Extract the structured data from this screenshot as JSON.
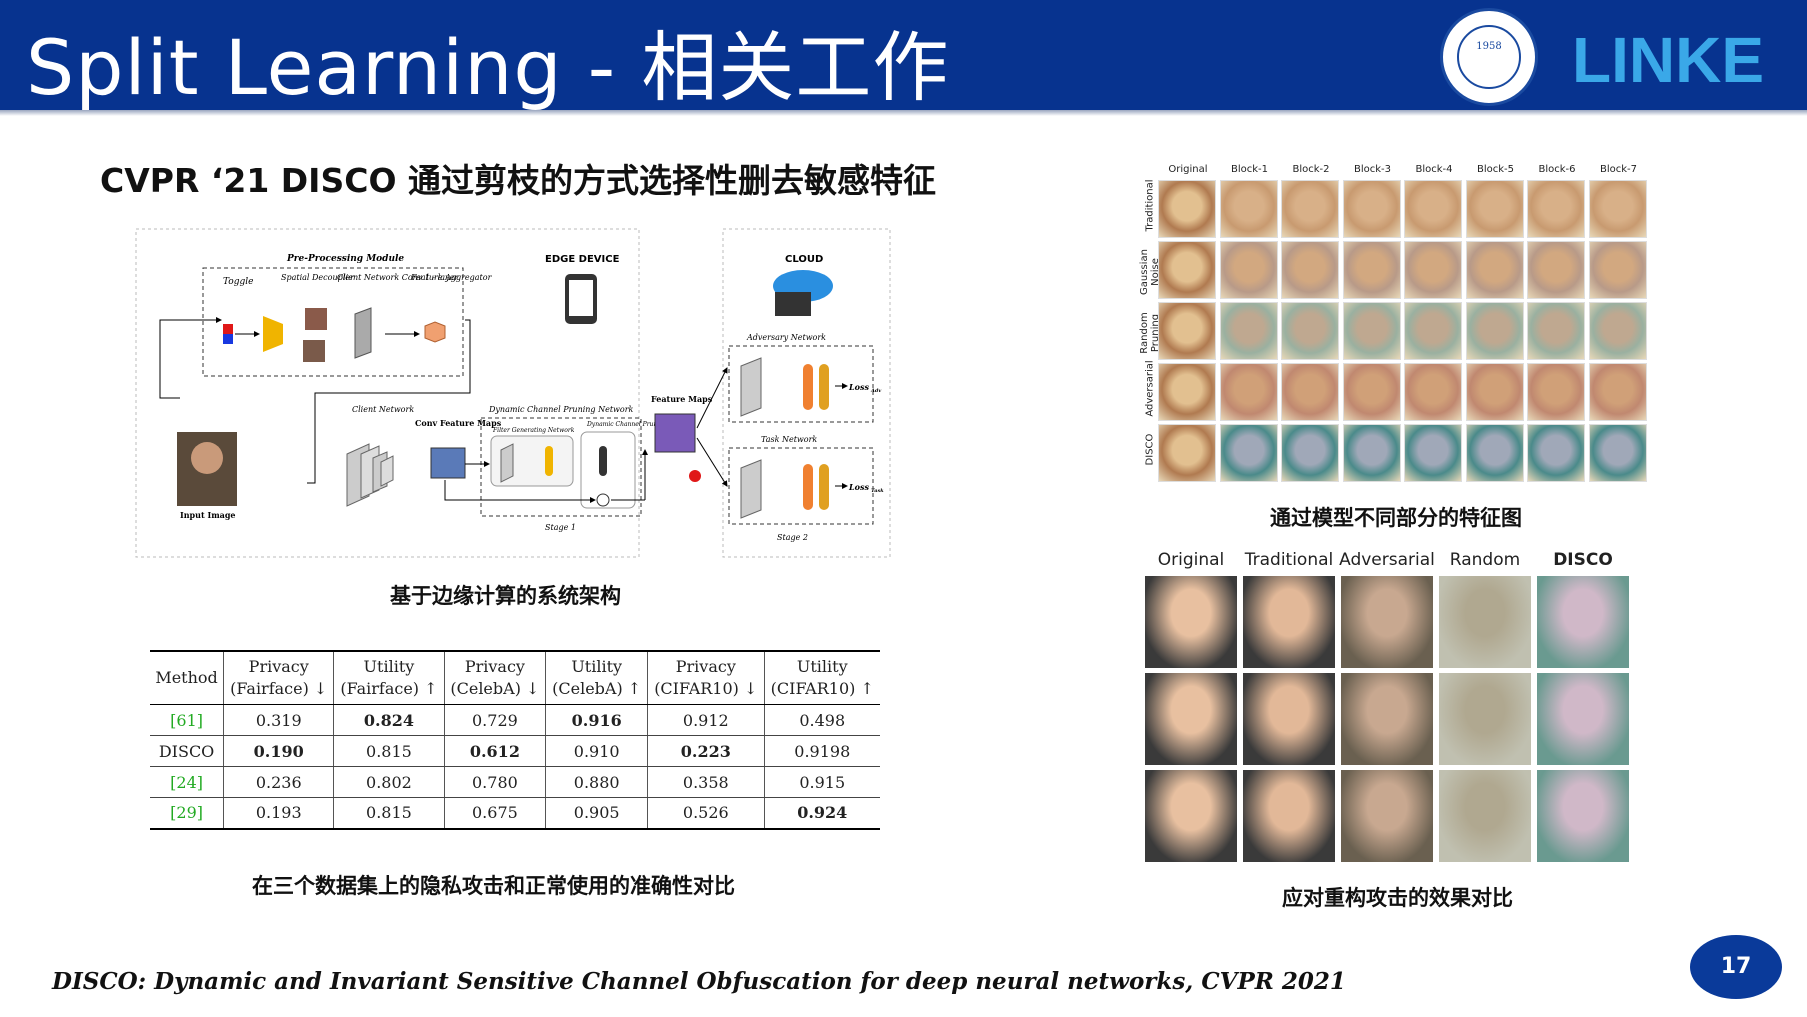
{
  "header": {
    "title": "Split Learning - 相关工作",
    "seal_year": "1958",
    "brand": "LINKE"
  },
  "subtitle": "CVPR ‘21 DISCO 通过剪枝的方式选择性删去敏感特征",
  "architecture": {
    "pre_processing_module": "Pre-Processing Module",
    "toggle": "Toggle",
    "spatial_decoupler": "Spatial Decoupler",
    "client_network_conv": "Client Network Conv 1 - layer",
    "feature_aggregator": "Feature Aggregator",
    "edge_device": "EDGE DEVICE",
    "cloud": "CLOUD",
    "adversary_network": "Adversary Network",
    "task_network": "Task Network",
    "client_network": "Client Network",
    "conv_feature_maps": "Conv Feature Maps",
    "dynamic_channel_pruning_network": "Dynamic Channel Pruning Network",
    "filter_generating_network": "Filter Generating Network",
    "dynamic_channel_pruning_layer": "Dynamic Channel Pruning Layer",
    "feature_maps": "Feature Maps",
    "input_image": "Input Image",
    "stage1": "Stage 1",
    "stage2": "Stage 2",
    "loss_adv": "Loss",
    "loss_adv_sub": "Adv",
    "loss_task": "Loss",
    "loss_task_sub": "Task",
    "conv": "CONV",
    "caption": "基于边缘计算的系统架构"
  },
  "table": {
    "headers": [
      [
        "Method",
        ""
      ],
      [
        "Privacy",
        "(Fairface) ↓"
      ],
      [
        "Utility",
        "(Fairface) ↑"
      ],
      [
        "Privacy",
        "(CelebA) ↓"
      ],
      [
        "Utility",
        "(CelebA) ↑"
      ],
      [
        "Privacy",
        "(CIFAR10) ↓"
      ],
      [
        "Utility",
        "(CIFAR10) ↑"
      ]
    ],
    "rows": [
      {
        "method": "[61]",
        "ref": true,
        "values": [
          "0.319",
          "0.824",
          "0.729",
          "0.916",
          "0.912",
          "0.498"
        ],
        "bold": [
          false,
          true,
          false,
          true,
          false,
          false
        ]
      },
      {
        "method": "DISCO",
        "ref": false,
        "values": [
          "0.190",
          "0.815",
          "0.612",
          "0.910",
          "0.223",
          "0.9198"
        ],
        "bold": [
          true,
          false,
          true,
          false,
          true,
          false
        ]
      },
      {
        "method": "[24]",
        "ref": true,
        "values": [
          "0.236",
          "0.802",
          "0.780",
          "0.880",
          "0.358",
          "0.915"
        ],
        "bold": [
          false,
          false,
          false,
          false,
          false,
          false
        ]
      },
      {
        "method": "[29]",
        "ref": true,
        "values": [
          "0.193",
          "0.815",
          "0.675",
          "0.905",
          "0.526",
          "0.924"
        ],
        "bold": [
          false,
          false,
          false,
          false,
          false,
          true
        ]
      }
    ],
    "caption": "在三个数据集上的隐私攻击和正常使用的准确性对比"
  },
  "feature_grid": {
    "columns": [
      "Original",
      "Block-1",
      "Block-2",
      "Block-3",
      "Block-4",
      "Block-5",
      "Block-6",
      "Block-7"
    ],
    "rows": [
      "Traditional",
      "Gaussian Noise",
      "Random Pruning",
      "Adversarial",
      "DISCO"
    ],
    "caption": "通过模型不同部分的特征图"
  },
  "reconstruction": {
    "columns": [
      "Original",
      "Traditional",
      "Adversarial",
      "Random",
      "DISCO"
    ],
    "caption": "应对重构攻击的效果对比"
  },
  "footer": {
    "reference": "DISCO: Dynamic and Invariant Sensitive Channel Obfuscation for deep neural networks, CVPR 2021",
    "page": "17"
  },
  "colors": {
    "header_bg": "#07338f",
    "ref_green": "#22aa22",
    "badge": "#0a3a9a"
  }
}
